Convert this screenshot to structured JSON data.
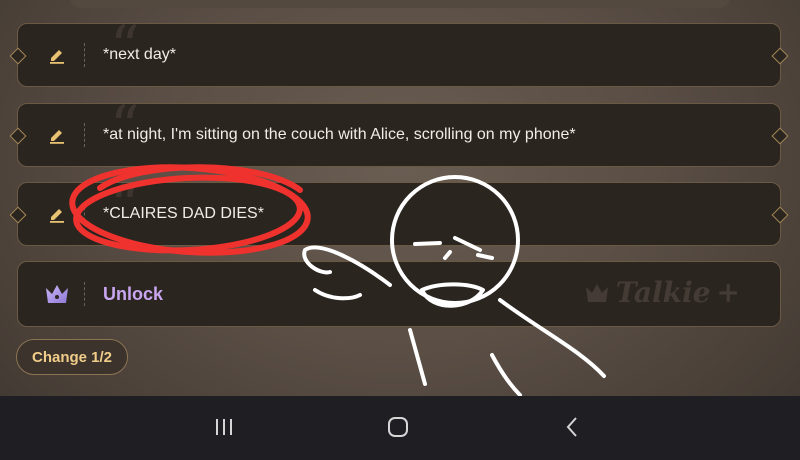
{
  "choices": [
    {
      "text": "*next day*"
    },
    {
      "text": "*at night, I'm sitting on the couch with Alice, scrolling on my phone*"
    },
    {
      "text": "*CLAIRES DAD DIES*"
    }
  ],
  "unlock": {
    "label": "Unlock"
  },
  "watermark": {
    "text": "Talkie"
  },
  "change_button": {
    "label": "Change 1/2"
  },
  "icons": {
    "edit": "pencil-icon",
    "unlock": "crown-icon",
    "nav_recents": "recents-icon",
    "nav_home": "home-icon",
    "nav_back": "back-icon"
  },
  "colors": {
    "accent_gold": "#f1cd8a",
    "unlock_purple": "#c9a6f0",
    "annotation_red": "#f0322e"
  }
}
